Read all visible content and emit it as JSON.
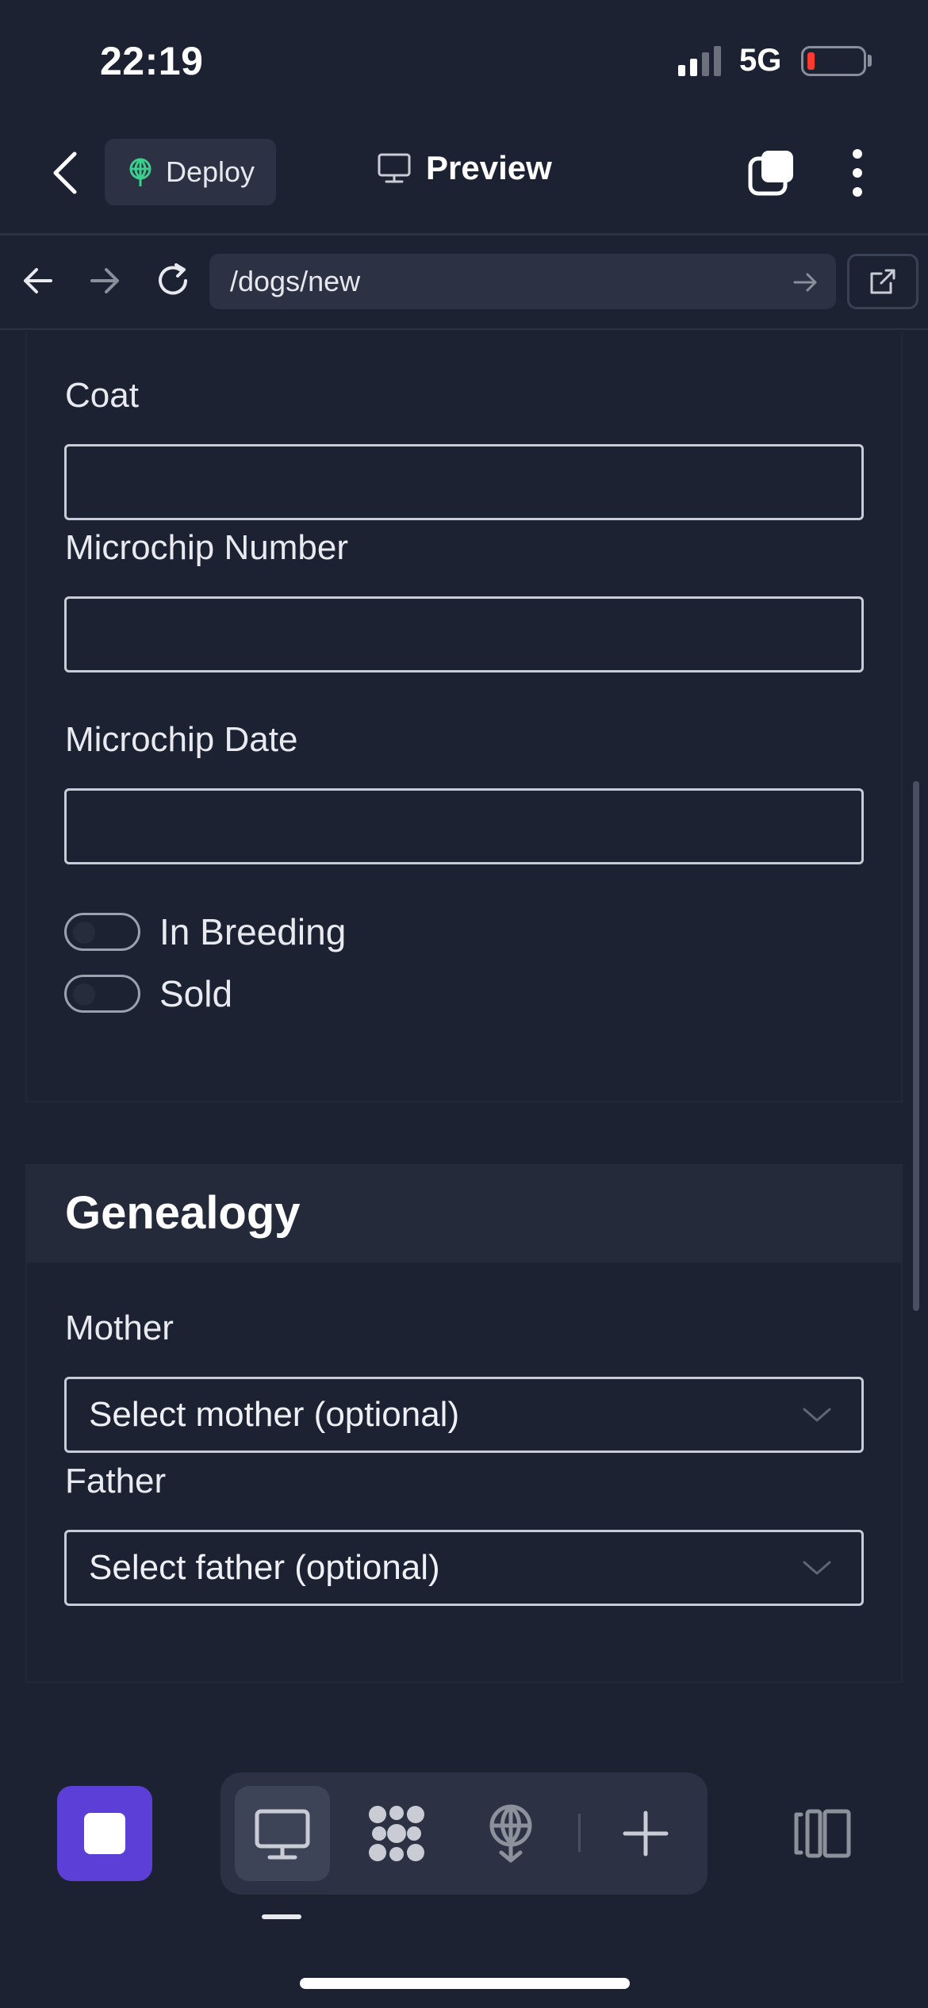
{
  "status_bar": {
    "time": "22:19",
    "network": "5G"
  },
  "top_bar": {
    "deploy_label": "Deploy",
    "preview_label": "Preview"
  },
  "browser": {
    "url": "/dogs/new"
  },
  "form": {
    "coat_label": "Coat",
    "microchip_number_label": "Microchip Number",
    "microchip_date_label": "Microchip Date",
    "toggles": [
      {
        "label": "In Breeding",
        "on": false
      },
      {
        "label": "Sold",
        "on": false
      }
    ]
  },
  "genealogy": {
    "title": "Genealogy",
    "mother_label": "Mother",
    "mother_placeholder": "Select mother (optional)",
    "father_label": "Father",
    "father_placeholder": "Select father (optional)"
  },
  "colors": {
    "background": "#1d2232",
    "accent": "#5b3fd6",
    "deploy_icon": "#3ecf8e",
    "battery_low": "#ff3b30"
  },
  "icons": [
    "chevron-left-icon",
    "deploy-icon",
    "monitor-icon",
    "tabs-icon",
    "more-vertical-icon",
    "arrow-left-icon",
    "arrow-right-icon",
    "reload-icon",
    "external-link-icon",
    "chevron-down-icon",
    "stop-icon",
    "grid-icon",
    "panel-icon",
    "plus-icon"
  ]
}
